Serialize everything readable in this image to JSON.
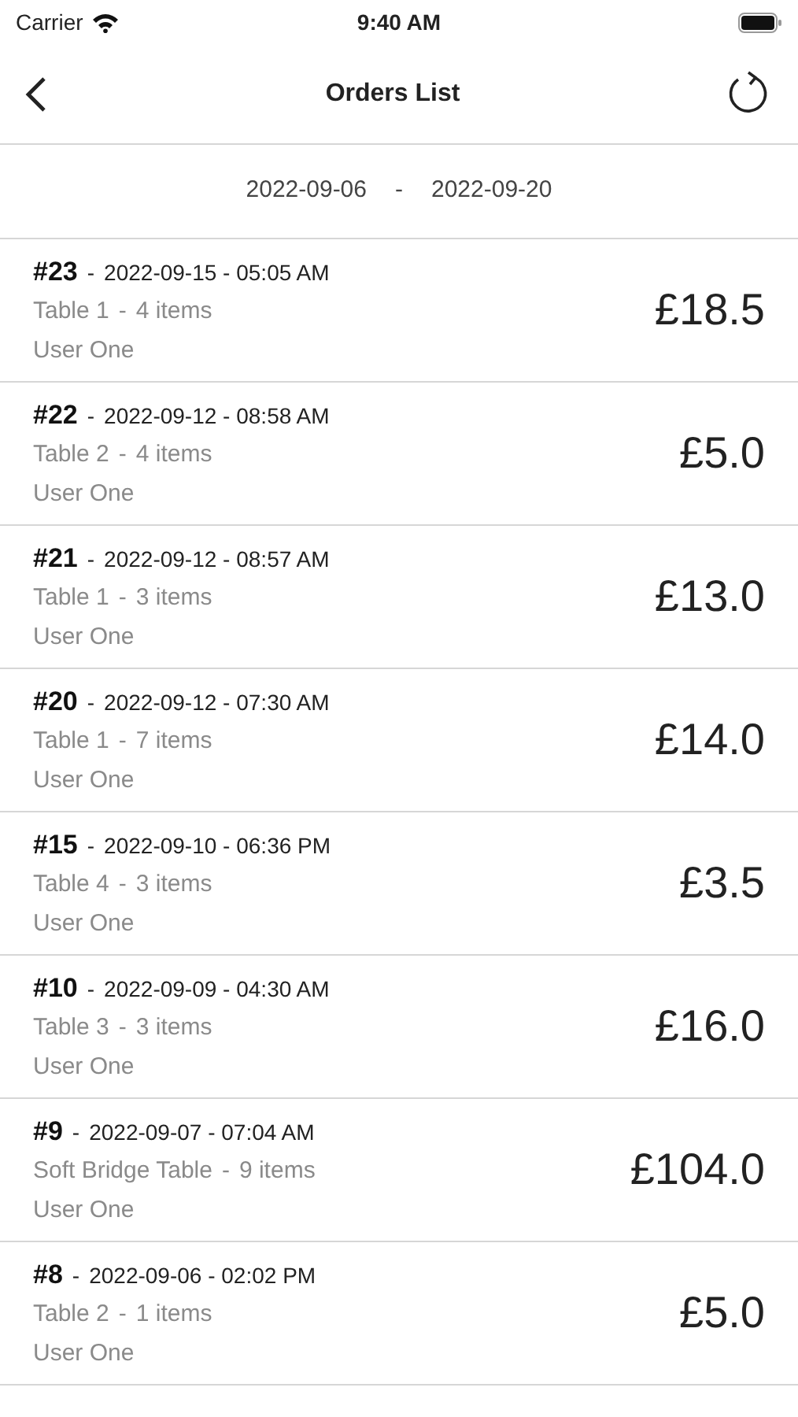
{
  "status_bar": {
    "carrier": "Carrier",
    "time": "9:40 AM"
  },
  "nav": {
    "title": "Orders List"
  },
  "date_range": {
    "from": "2022-09-06",
    "separator": "-",
    "to": "2022-09-20"
  },
  "orders": [
    {
      "number": "#23",
      "sep": "-",
      "datetime": "2022-09-15 - 05:05 AM",
      "table": "Table 1",
      "sep2": "-",
      "items": "4 items",
      "user": "User One",
      "total": "£18.5"
    },
    {
      "number": "#22",
      "sep": "-",
      "datetime": "2022-09-12 - 08:58 AM",
      "table": "Table 2",
      "sep2": "-",
      "items": "4 items",
      "user": "User One",
      "total": "£5.0"
    },
    {
      "number": "#21",
      "sep": "-",
      "datetime": "2022-09-12 - 08:57 AM",
      "table": "Table 1",
      "sep2": "-",
      "items": "3 items",
      "user": "User One",
      "total": "£13.0"
    },
    {
      "number": "#20",
      "sep": "-",
      "datetime": "2022-09-12 - 07:30 AM",
      "table": "Table 1",
      "sep2": "-",
      "items": "7 items",
      "user": "User One",
      "total": "£14.0"
    },
    {
      "number": "#15",
      "sep": "-",
      "datetime": "2022-09-10 - 06:36 PM",
      "table": "Table 4",
      "sep2": "-",
      "items": "3 items",
      "user": "User One",
      "total": "£3.5"
    },
    {
      "number": "#10",
      "sep": "-",
      "datetime": "2022-09-09 - 04:30 AM",
      "table": "Table 3",
      "sep2": "-",
      "items": "3 items",
      "user": "User One",
      "total": "£16.0"
    },
    {
      "number": "#9",
      "sep": "-",
      "datetime": "2022-09-07 - 07:04 AM",
      "table": "Soft Bridge Table",
      "sep2": "-",
      "items": "9 items",
      "user": "User One",
      "total": "£104.0"
    },
    {
      "number": "#8",
      "sep": "-",
      "datetime": "2022-09-06 - 02:02 PM",
      "table": "Table 2",
      "sep2": "-",
      "items": "1 items",
      "user": "User One",
      "total": "£5.0"
    }
  ]
}
